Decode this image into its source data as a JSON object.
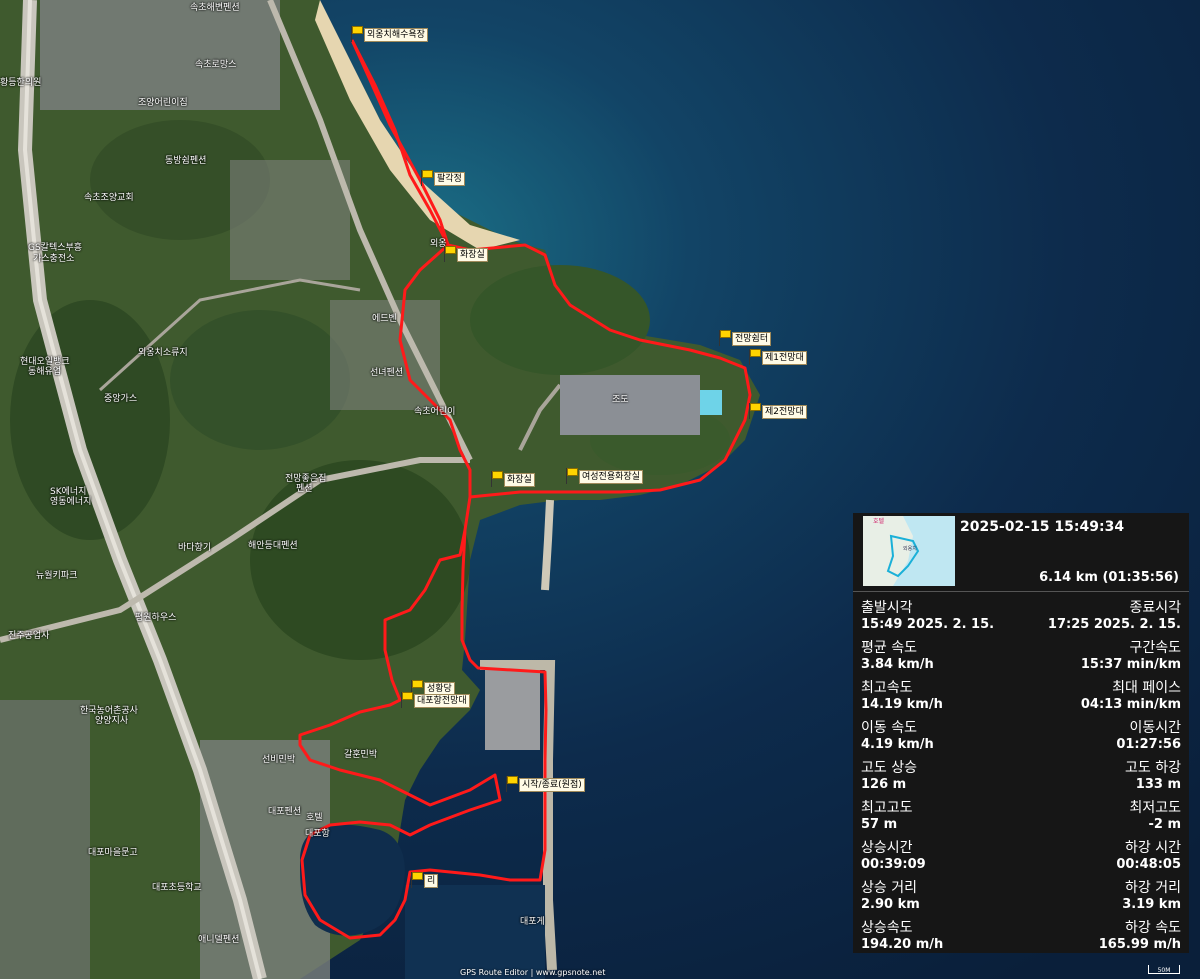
{
  "waypoints": [
    {
      "id": "wp-oeongchi-beach",
      "label": "외옹치해수욕장"
    },
    {
      "id": "wp-palgakjeong",
      "label": "팔각정"
    },
    {
      "id": "wp-toilet-north",
      "label": "화장실"
    },
    {
      "id": "wp-jeonmang-shelter",
      "label": "전망쉼터"
    },
    {
      "id": "wp-observatory-1",
      "label": "제1전망대"
    },
    {
      "id": "wp-observatory-2",
      "label": "제2전망대"
    },
    {
      "id": "wp-toilet-south",
      "label": "화장실"
    },
    {
      "id": "wp-women-toilet",
      "label": "여성전용화장실"
    },
    {
      "id": "wp-seonghwangdang",
      "label": "성황당"
    },
    {
      "id": "wp-daepohang-observatory",
      "label": "대포항전망대"
    },
    {
      "id": "wp-start-end",
      "label": "시작/종료(원점)"
    },
    {
      "id": "wp-bridge",
      "label": "리"
    }
  ],
  "places": {
    "p1": "속초해변펜션",
    "p2": "속초로망스",
    "p3": "조양어린이집",
    "p4": "동방쉼펜션",
    "p5": "속초조양교회",
    "p6": "GS칼텍스부흥",
    "p7": "가스충전소",
    "p8": "외옹치소류지",
    "p9": "현대오일뱅크",
    "p10": "동해유업",
    "p11": "중앙가스",
    "p12": "SK에너지",
    "p13": "영동에너지",
    "p14": "전망좋은집",
    "p15": "펜션",
    "p16": "바다향기",
    "p17": "해안등대펜션",
    "p18": "선녀펜션",
    "p19": "속초어린이",
    "p20": "조도",
    "p21": "대포항",
    "p22": "대포펜션",
    "p23": "대포마을문고",
    "p24": "대포초등학교",
    "p25": "애니델펜션",
    "p26": "진주공업사",
    "p27": "한국농어촌공사",
    "p28": "양양지사",
    "p29": "평원하우스",
    "p30": "뉴월키파크",
    "p31": "대포게",
    "p32": "호텔",
    "p33": "선비민박",
    "p34": "갈훈민박",
    "p35": "에드벤",
    "p36": "황등한의원",
    "p37": "외옹"
  },
  "panel": {
    "datetime": "2025-02-15 15:49:34",
    "distance": "6.14 km (01:35:56)",
    "stats": [
      {
        "kl": "출발시각",
        "vl": "15:49 2025. 2. 15.",
        "kr": "종료시각",
        "vr": "17:25 2025. 2. 15."
      },
      {
        "kl": "평균 속도",
        "vl": "3.84 km/h",
        "kr": "구간속도",
        "vr": "15:37 min/km"
      },
      {
        "kl": "최고속도",
        "vl": "14.19 km/h",
        "kr": "최대 페이스",
        "vr": "04:13 min/km"
      },
      {
        "kl": "이동 속도",
        "vl": "4.19 km/h",
        "kr": "이동시간",
        "vr": "01:27:56"
      },
      {
        "kl": "고도 상승",
        "vl": "126 m",
        "kr": "고도 하강",
        "vr": "133 m"
      },
      {
        "kl": "최고고도",
        "vl": "57 m",
        "kr": "최저고도",
        "vr": "-2 m"
      },
      {
        "kl": "상승시간",
        "vl": "00:39:09",
        "kr": "하강 시간",
        "vr": "00:48:05"
      },
      {
        "kl": "상승 거리",
        "vl": "2.90 km",
        "kr": "하강 거리",
        "vr": "3.19 km"
      },
      {
        "kl": "상승속도",
        "vl": "194.20 m/h",
        "kr": "하강 속도",
        "vr": "165.99 m/h"
      }
    ],
    "thumb_label": "호텔",
    "thumb_label2": "외옹치"
  },
  "footer": "GPS Route Editor | www.gpsnote.net",
  "scale": "50M",
  "colors": {
    "route": "#ff1a1a",
    "sea_deep": "#0c2848",
    "sea_near": "#16506a",
    "land": "#3d5a2c",
    "sand": "#e8d9b5",
    "urban": "#8a8f8a"
  }
}
